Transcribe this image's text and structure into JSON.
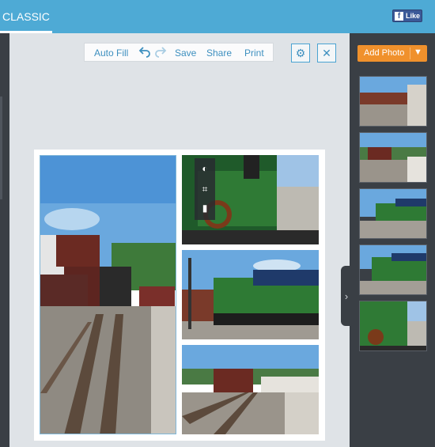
{
  "header": {
    "tab_label": "CLASSIC",
    "fb_like_label": "Like",
    "fb_icon": "f"
  },
  "toolbar": {
    "auto_fill": "Auto Fill",
    "save": "Save",
    "share": "Share",
    "print": "Print",
    "undo_icon": "undo-arrow",
    "redo_icon": "redo-arrow"
  },
  "buttons": {
    "settings_icon": "gear-icon",
    "close_icon": "close-icon",
    "settings_glyph": "⚙",
    "close_glyph": "✕"
  },
  "sidebar": {
    "add_photo_label": "Add Photo",
    "collapse_glyph": "›"
  },
  "edit_tools": {
    "contrast_glyph": "◐",
    "crop_glyph": "⌗",
    "flip_glyph": "▮"
  },
  "colors": {
    "topbar": "#4eaad5",
    "panel": "#3a3f45",
    "accent_orange": "#f0912c",
    "link_blue": "#3d8fbf"
  }
}
